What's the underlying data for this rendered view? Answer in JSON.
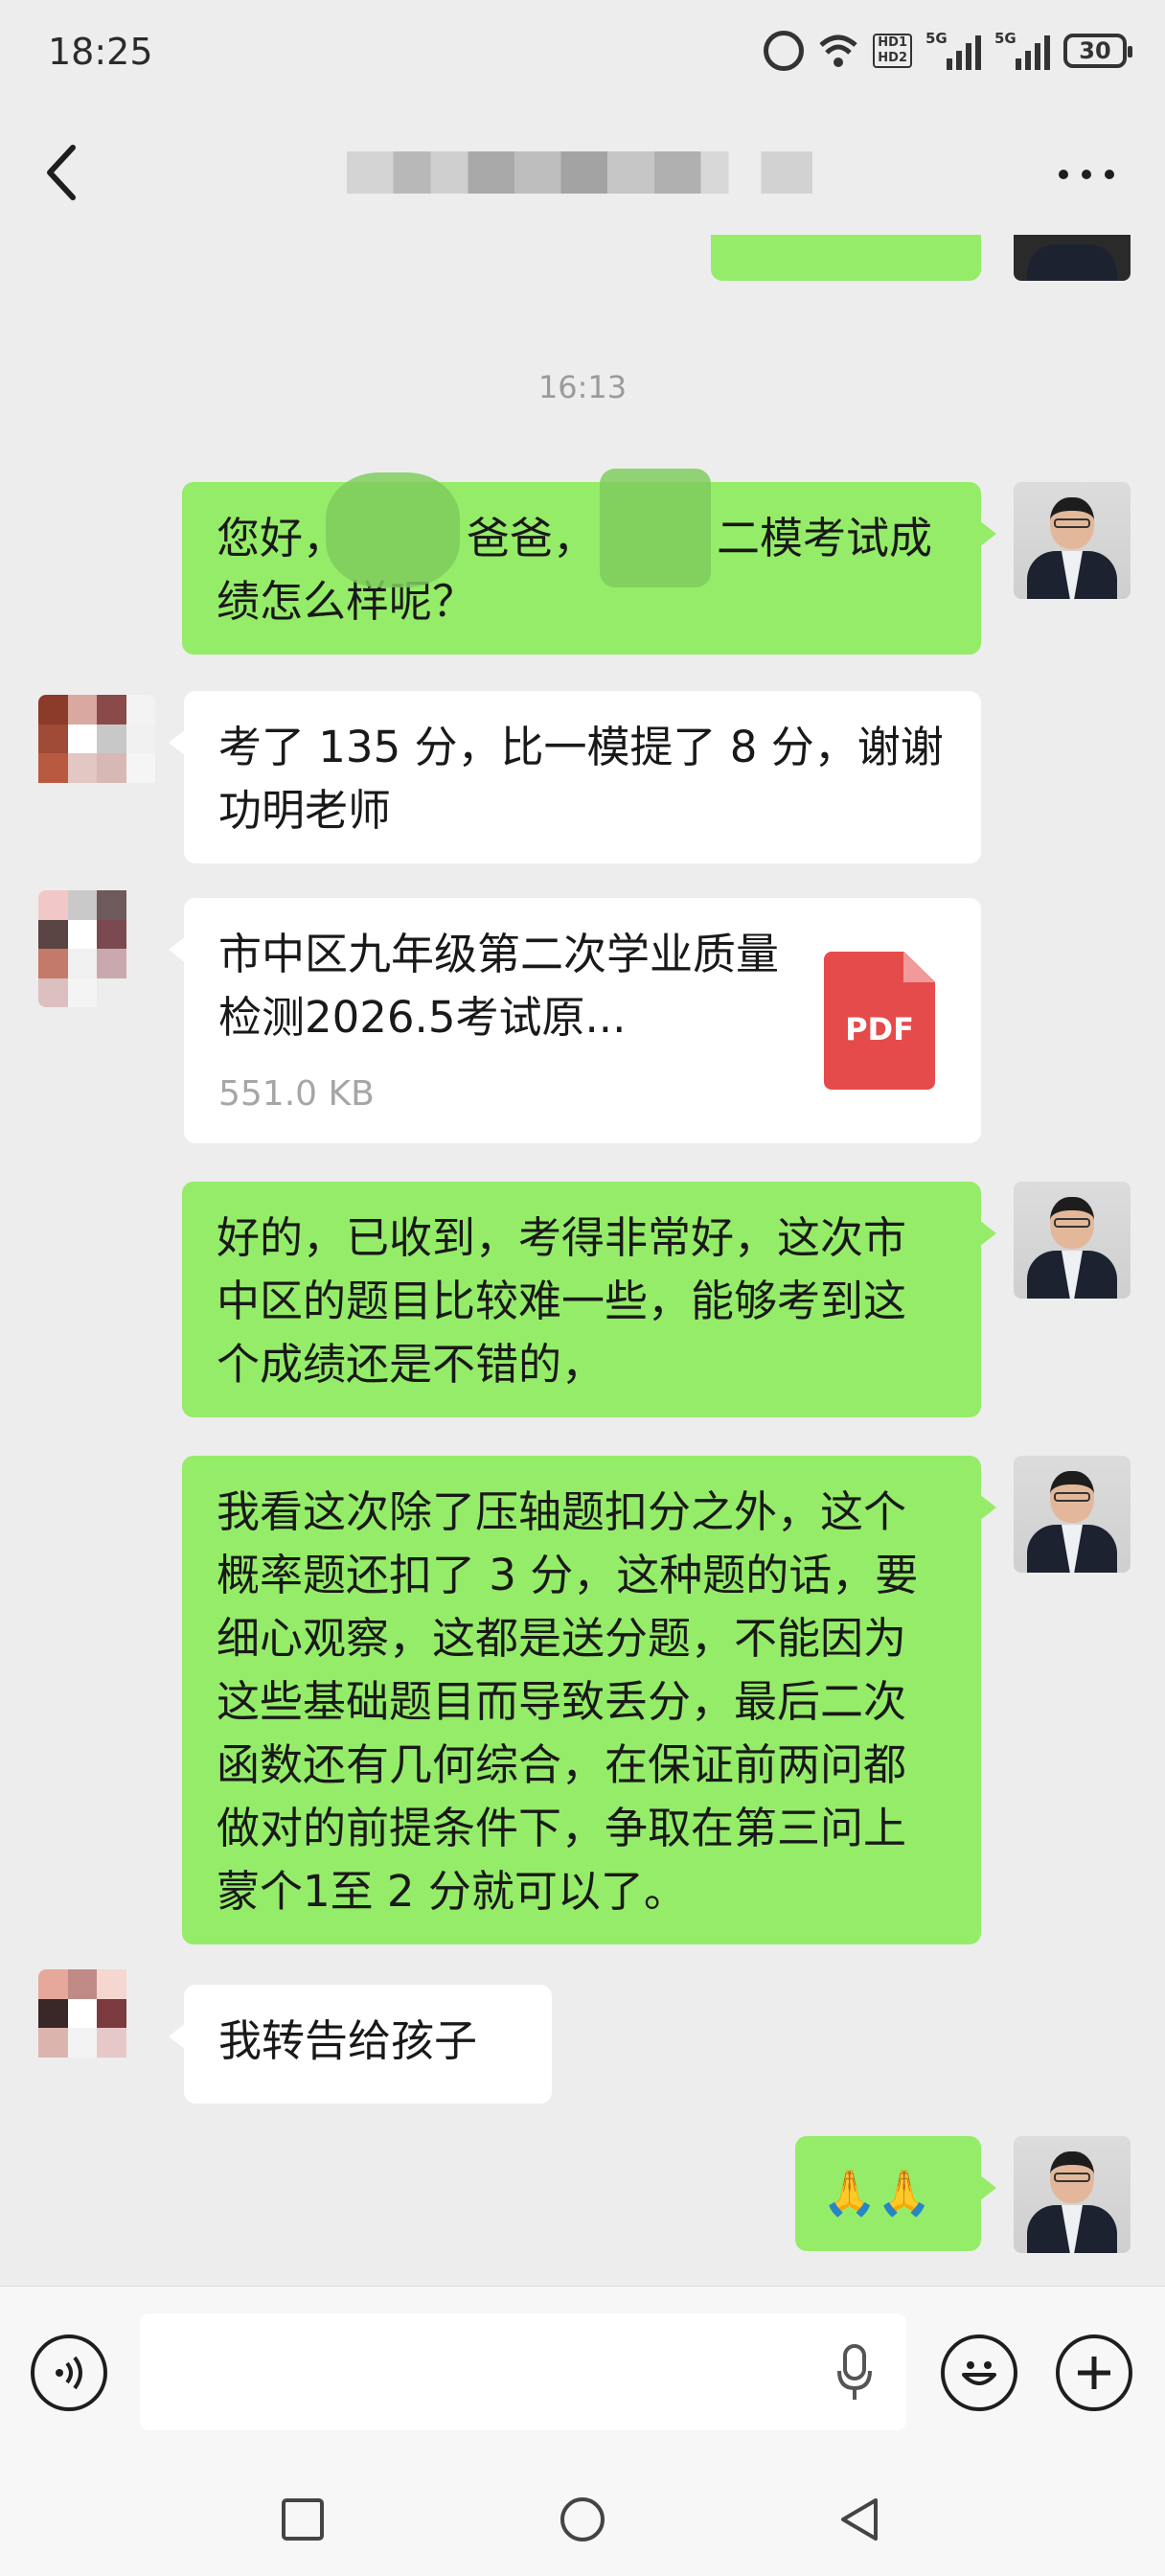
{
  "status_bar": {
    "time": "18:25",
    "hd_label_1": "HD1",
    "hd_label_2": "HD2",
    "network_1": "5G",
    "network_2": "5G",
    "battery": "30"
  },
  "nav": {
    "back_icon": "chevron-left-icon",
    "more_icon": "more-horizontal-icon",
    "more_label": "…"
  },
  "messages": {
    "timestamp": "16:13",
    "m1": "您好，",
    "m1_b": "爸爸，",
    "m1_c": "二模考试成绩怎么样呢？",
    "m2": "考了 135 分，比一模提了 8 分，谢谢功明老师",
    "m3_file_name": "市中区九年级第二次学业质量检测2026.5考试原...",
    "m3_file_size": "551.0 KB",
    "m3_file_icon": "PDF",
    "m4": "好的，已收到，考得非常好，这次市中区的题目比较难一些，能够考到这个成绩还是不错的，",
    "m5": "我看这次除了压轴题扣分之外，这个概率题还扣了 3 分，这种题的话，要细心观察，这都是送分题，不能因为这些基础题目而导致丢分，最后二次函数还有几何综合，在保证前两问都做对的前提条件下，争取在第三问上蒙个1至 2 分就可以了。",
    "m6": "我转告给孩子",
    "m7": "🙏🙏"
  },
  "input_bar": {
    "voice_icon": "voice-icon",
    "mic_icon": "microphone-icon",
    "emoji_icon": "emoji-icon",
    "plus_icon": "plus-icon"
  },
  "colors": {
    "background": "#ededed",
    "outgoing_bubble": "#95ec69",
    "incoming_bubble": "#ffffff",
    "pdf_red": "#e64b4b"
  }
}
